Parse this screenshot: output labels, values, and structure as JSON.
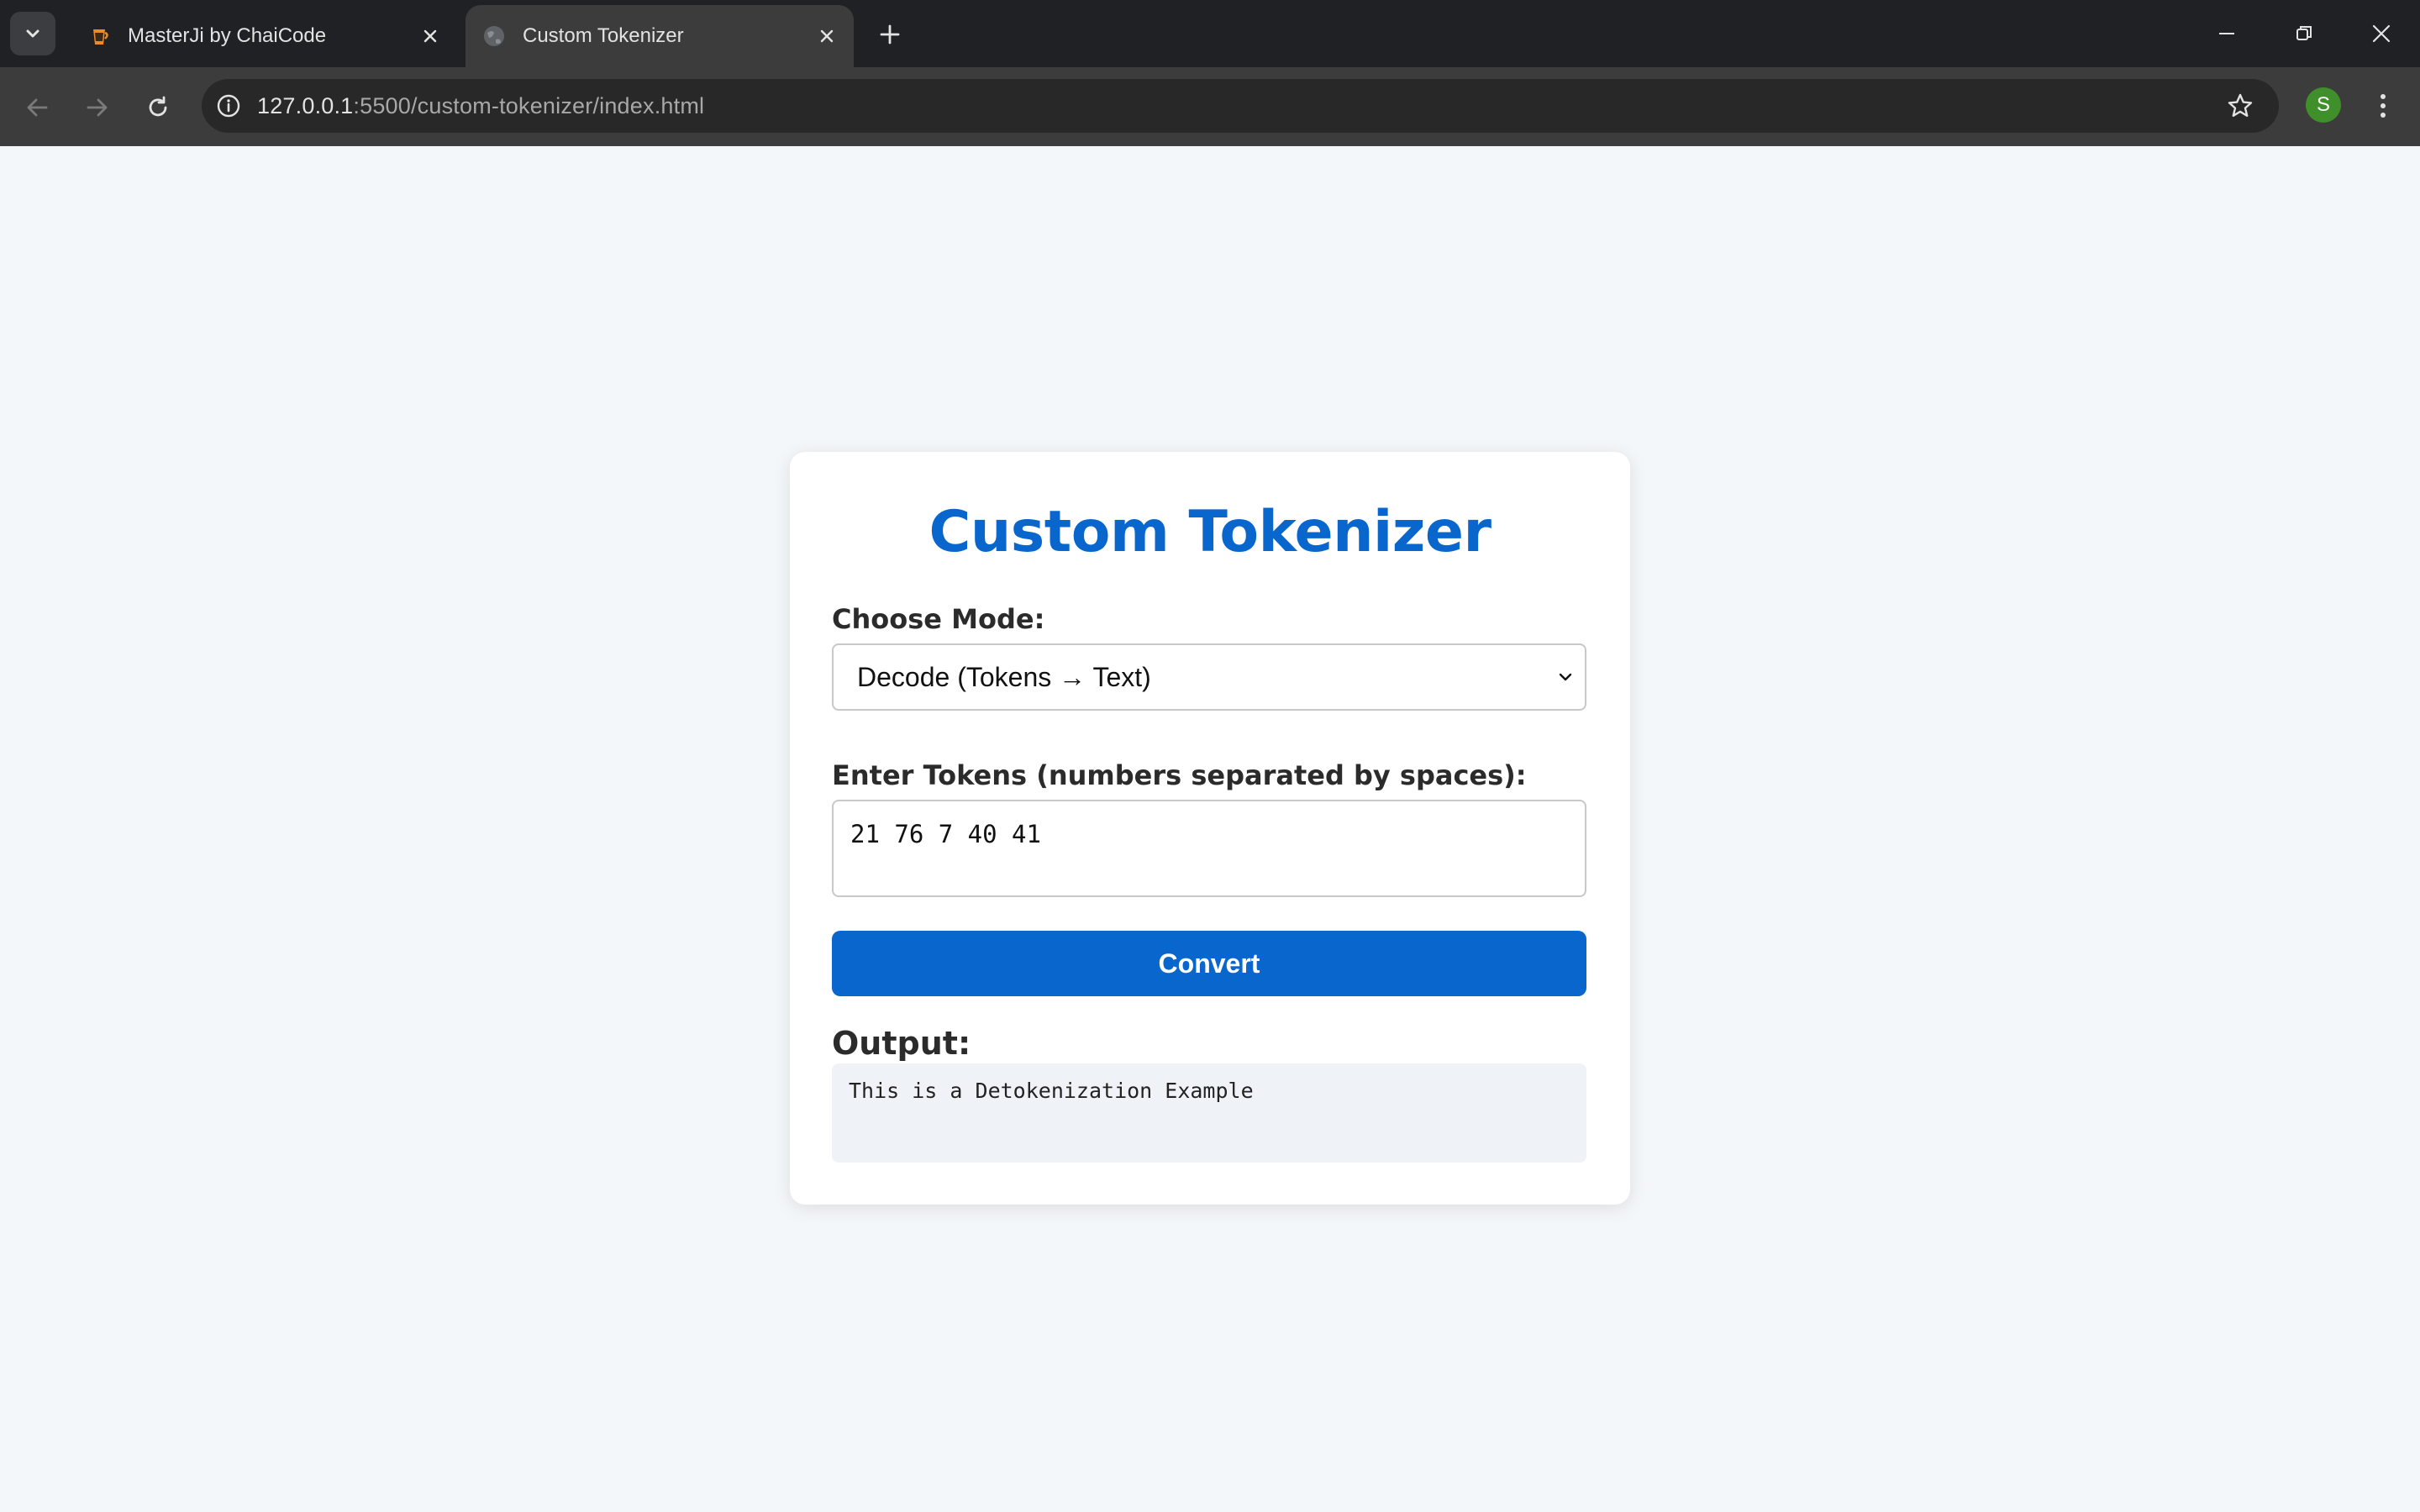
{
  "browser": {
    "tabs": [
      {
        "title": "MasterJi by ChaiCode",
        "active": false
      },
      {
        "title": "Custom Tokenizer",
        "active": true
      }
    ],
    "url_host": "127.0.0.1",
    "url_path": ":5500/custom-tokenizer/index.html",
    "profile_initial": "S"
  },
  "page": {
    "title": "Custom Tokenizer",
    "mode_label": "Choose Mode:",
    "mode_selected": "Decode (Tokens → Text)",
    "tokens_label": "Enter Tokens (numbers separated by spaces):",
    "tokens_value": "21 76 7 40 41",
    "convert_label": "Convert",
    "output_label": "Output:",
    "output_value": "This is a Detokenization Example"
  },
  "colors": {
    "accent": "#0866cc",
    "page_background": "#f4f7fa",
    "profile_avatar": "#3f8f2b"
  },
  "icons": [
    "tab-search-icon",
    "chaicode-favicon",
    "globe-icon",
    "close-icon",
    "plus-icon",
    "minimize-icon",
    "restore-icon",
    "back-icon",
    "forward-icon",
    "reload-icon",
    "info-icon",
    "star-icon",
    "kebab-menu-icon",
    "chevron-down-icon"
  ]
}
